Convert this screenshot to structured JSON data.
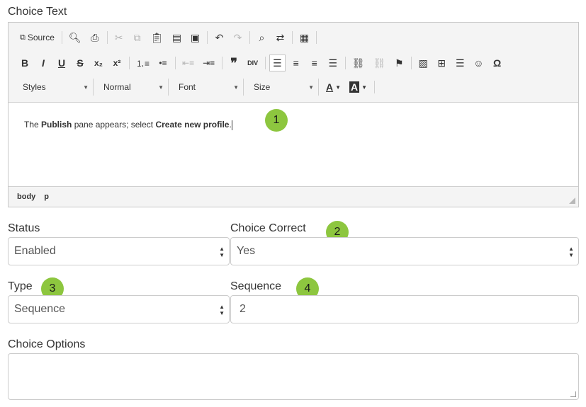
{
  "choice_text": {
    "label": "Choice Text",
    "toolbar": {
      "source_label": "Source",
      "styles_label": "Styles",
      "format_label": "Normal",
      "font_label": "Font",
      "size_label": "Size",
      "text_color_glyph": "A",
      "bg_color_glyph": "A"
    },
    "content": {
      "part1": "The ",
      "bold1": "Publish",
      "part2": " pane appears; select ",
      "bold2": "Create new profile",
      "part3": "."
    },
    "path": [
      "body",
      "p"
    ]
  },
  "status": {
    "label": "Status",
    "value": "Enabled"
  },
  "choice_correct": {
    "label": "Choice Correct",
    "value": "Yes"
  },
  "type": {
    "label": "Type",
    "value": "Sequence"
  },
  "sequence": {
    "label": "Sequence",
    "value": "2"
  },
  "choice_options": {
    "label": "Choice Options",
    "value": ""
  },
  "callouts": [
    "1",
    "2",
    "3",
    "4"
  ],
  "colors": {
    "callout": "#8dc63f",
    "toolbar_bg": "#f4f4f4",
    "border": "#cccccc"
  }
}
